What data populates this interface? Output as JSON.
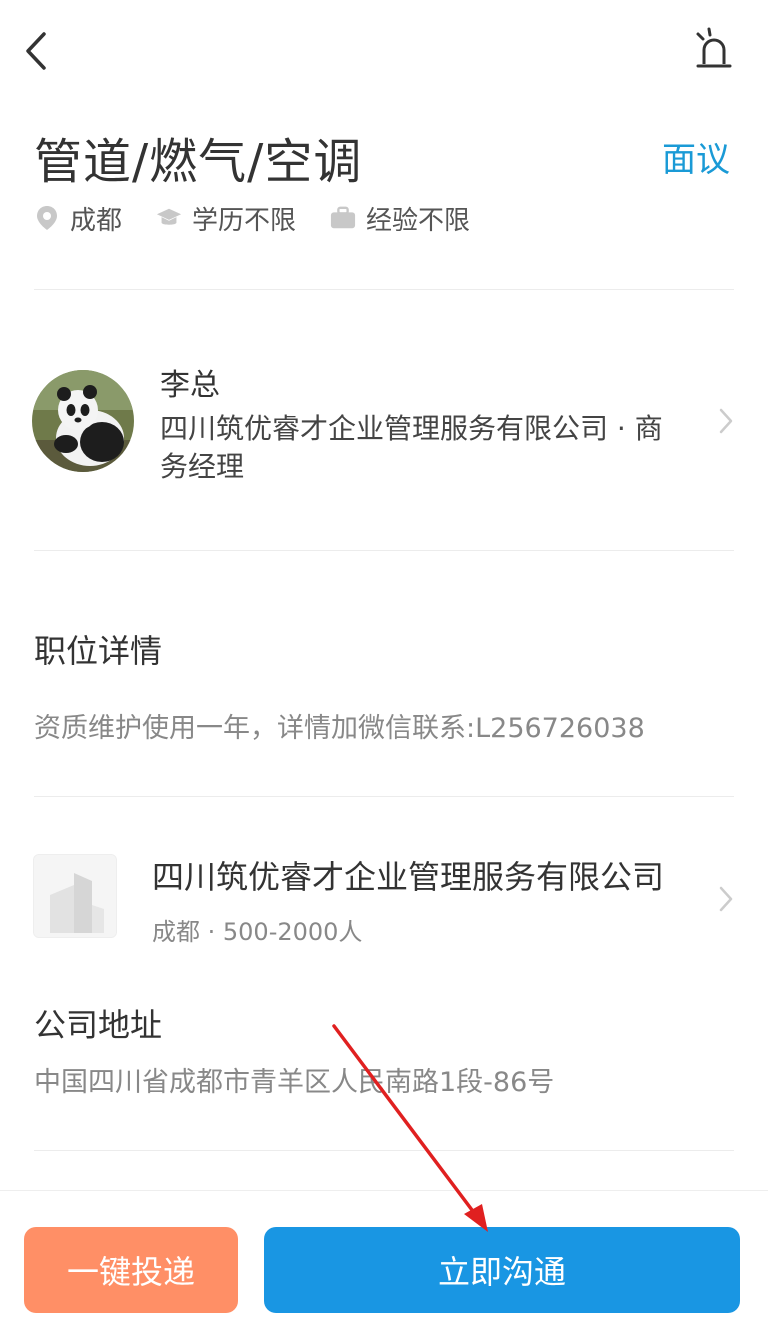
{
  "header": {
    "back_icon": "chevron-left-icon",
    "alarm_icon": "siren-icon"
  },
  "job": {
    "title": "管道/燃气/空调",
    "salary": "面议",
    "meta": [
      {
        "icon": "location-pin-icon",
        "text": "成都"
      },
      {
        "icon": "graduation-cap-icon",
        "text": "学历不限"
      },
      {
        "icon": "briefcase-icon",
        "text": "经验不限"
      }
    ]
  },
  "recruiter": {
    "name": "李总",
    "company_line1": "四川筑优睿才企业管理服务有限公司 · 商",
    "company_line2": "务经理"
  },
  "details": {
    "title": "职位详情",
    "description": "资质维护使用一年，详情加微信联系:L256726038"
  },
  "company": {
    "name": "四川筑优睿才企业管理服务有限公司",
    "info": "成都 · 500-2000人"
  },
  "address": {
    "title": "公司地址",
    "text": "中国四川省成都市青羊区人民南路1段-86号"
  },
  "actions": {
    "apply_label": "一键投递",
    "chat_label": "立即沟通"
  },
  "colors": {
    "accent": "#1a9ad6",
    "apply_button": "#ff8f66",
    "chat_button": "#1996e3",
    "annotation_arrow": "#e02020"
  }
}
